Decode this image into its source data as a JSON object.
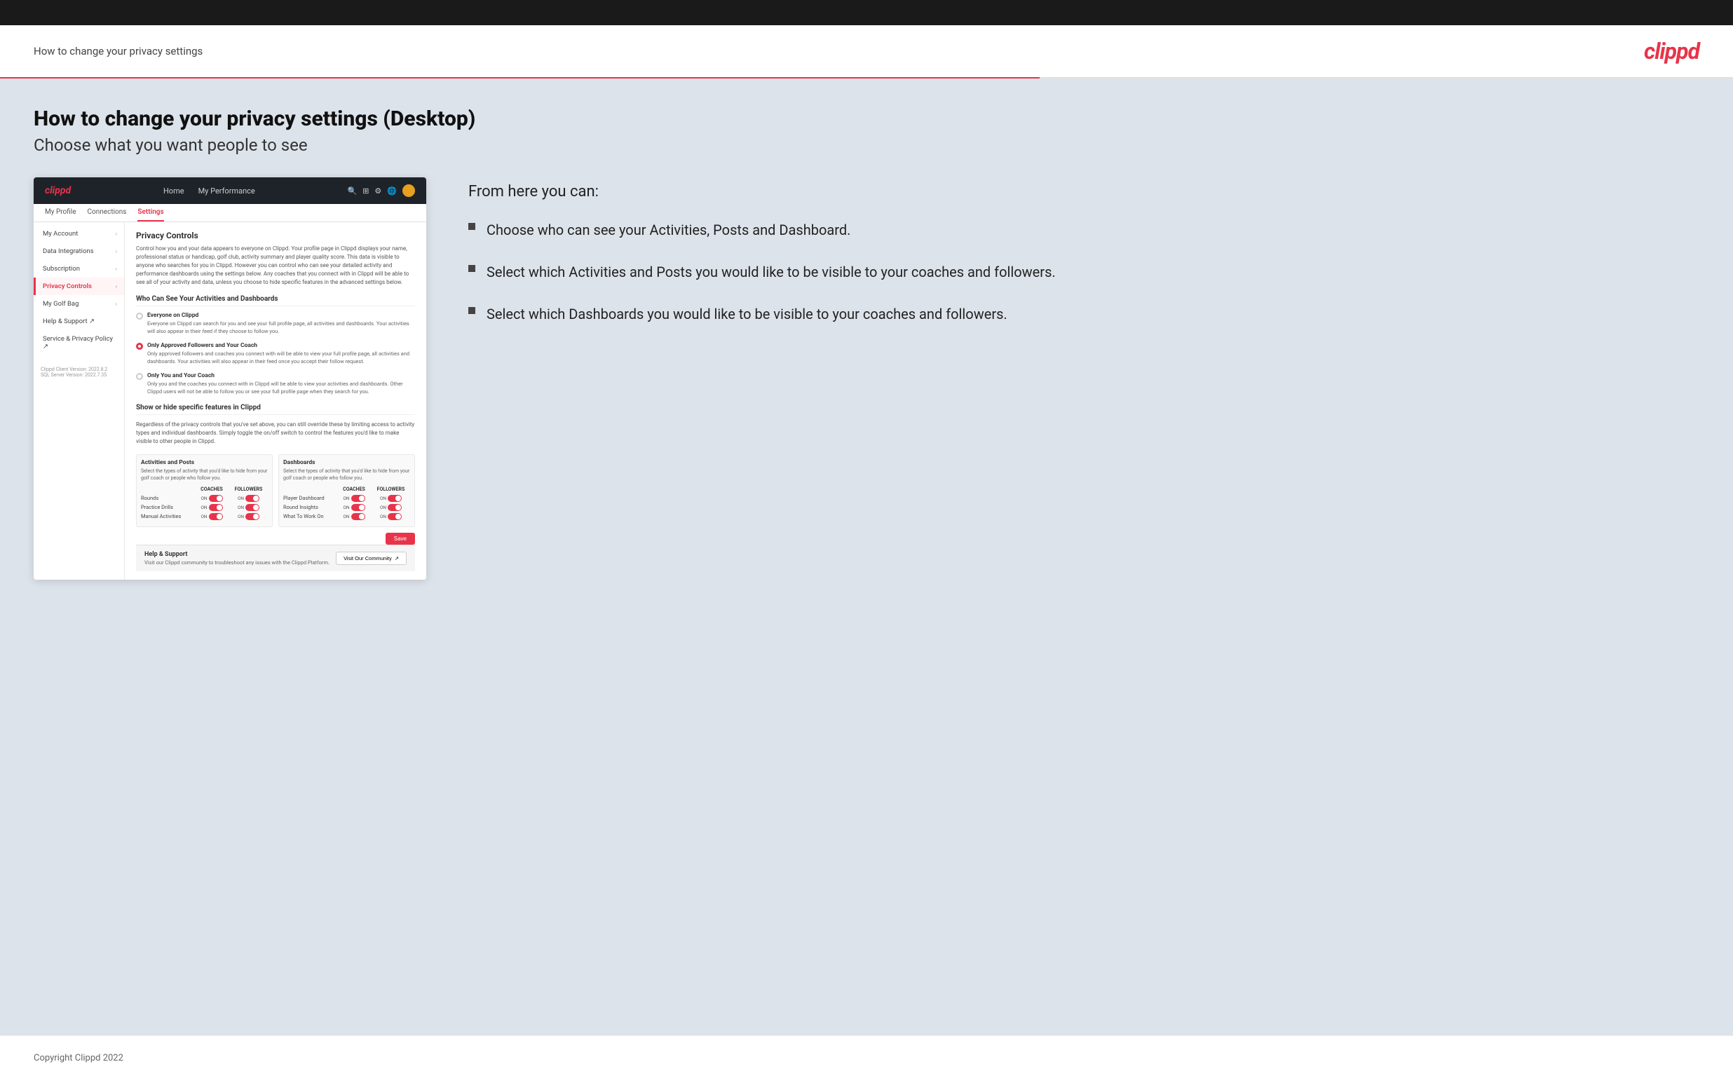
{
  "topBar": {},
  "header": {
    "title": "How to change your privacy settings",
    "logo": "clippd"
  },
  "mainContent": {
    "heading": "How to change your privacy settings (Desktop)",
    "subheading": "Choose what you want people to see"
  },
  "screenshot": {
    "navbar": {
      "logo": "clippd",
      "links": [
        "Home",
        "My Performance"
      ],
      "icons": [
        "search",
        "grid",
        "settings",
        "globe",
        "avatar"
      ]
    },
    "subnav": {
      "items": [
        {
          "label": "My Profile",
          "active": false
        },
        {
          "label": "Connections",
          "active": false
        },
        {
          "label": "Settings",
          "active": true
        }
      ]
    },
    "sidebar": {
      "items": [
        {
          "label": "My Account",
          "active": false
        },
        {
          "label": "Data Integrations",
          "active": false
        },
        {
          "label": "Subscription",
          "active": false
        },
        {
          "label": "Privacy Controls",
          "active": true
        },
        {
          "label": "My Golf Bag",
          "active": false
        },
        {
          "label": "Help & Support",
          "active": false,
          "external": true
        },
        {
          "label": "Service & Privacy Policy",
          "active": false,
          "external": true
        }
      ],
      "version": "Clippd Client Version: 2022.8.2\nSQL Server Version: 2022.7.35"
    },
    "mainPanel": {
      "title": "Privacy Controls",
      "description": "Control how you and your data appears to everyone on Clippd. Your profile page in Clippd displays your name, professional status or handicap, golf club, activity summary and player quality score. This data is visible to anyone who searches for you in Clippd. However you can control who can see your detailed activity and performance dashboards using the settings below. Any coaches that you connect with in Clippd will be able to see all of your activity and data, unless you choose to hide specific features in the advanced settings below.",
      "whoCanSee": {
        "title": "Who Can See Your Activities and Dashboards",
        "options": [
          {
            "label": "Everyone on Clippd",
            "desc": "Everyone on Clippd can search for you and see your full profile page, all activities and dashboards. Your activities will also appear in their feed if they choose to follow you.",
            "selected": false
          },
          {
            "label": "Only Approved Followers and Your Coach",
            "desc": "Only approved followers and coaches you connect with will be able to view your full profile page, all activities and dashboards. Your activities will also appear in their feed once you accept their follow request.",
            "selected": true
          },
          {
            "label": "Only You and Your Coach",
            "desc": "Only you and the coaches you connect with in Clippd will be able to view your activities and dashboards. Other Clippd users will not be able to follow you or see your full profile page when they search for you.",
            "selected": false
          }
        ]
      },
      "showHide": {
        "title": "Show or hide specific features in Clippd",
        "desc": "Regardless of the privacy controls that you've set above, you can still override these by limiting access to activity types and individual dashboards. Simply toggle the on/off switch to control the features you'd like to make visible to other people in Clippd.",
        "activitiesPosts": {
          "title": "Activities and Posts",
          "desc": "Select the types of activity that you'd like to hide from your golf coach or people who follow you.",
          "colLabels": [
            "COACHES",
            "FOLLOWERS"
          ],
          "rows": [
            {
              "label": "Rounds",
              "coaches": "ON",
              "followers": "ON"
            },
            {
              "label": "Practice Drills",
              "coaches": "ON",
              "followers": "ON"
            },
            {
              "label": "Manual Activities",
              "coaches": "ON",
              "followers": "ON"
            }
          ]
        },
        "dashboards": {
          "title": "Dashboards",
          "desc": "Select the types of activity that you'd like to hide from your golf coach or people who follow you.",
          "colLabels": [
            "COACHES",
            "FOLLOWERS"
          ],
          "rows": [
            {
              "label": "Player Dashboard",
              "coaches": "ON",
              "followers": "ON"
            },
            {
              "label": "Round Insights",
              "coaches": "ON",
              "followers": "ON"
            },
            {
              "label": "What To Work On",
              "coaches": "ON",
              "followers": "ON"
            }
          ]
        }
      },
      "saveLabel": "Save",
      "help": {
        "title": "Help & Support",
        "desc": "Visit our Clippd community to troubleshoot any issues with the Clippd Platform.",
        "buttonLabel": "Visit Our Community"
      }
    }
  },
  "infoPanel": {
    "fromHereTitle": "From here you can:",
    "bullets": [
      "Choose who can see your Activities, Posts and Dashboard.",
      "Select which Activities and Posts you would like to be visible to your coaches and followers.",
      "Select which Dashboards you would like to be visible to your coaches and followers."
    ]
  },
  "footer": {
    "text": "Copyright Clippd 2022"
  }
}
